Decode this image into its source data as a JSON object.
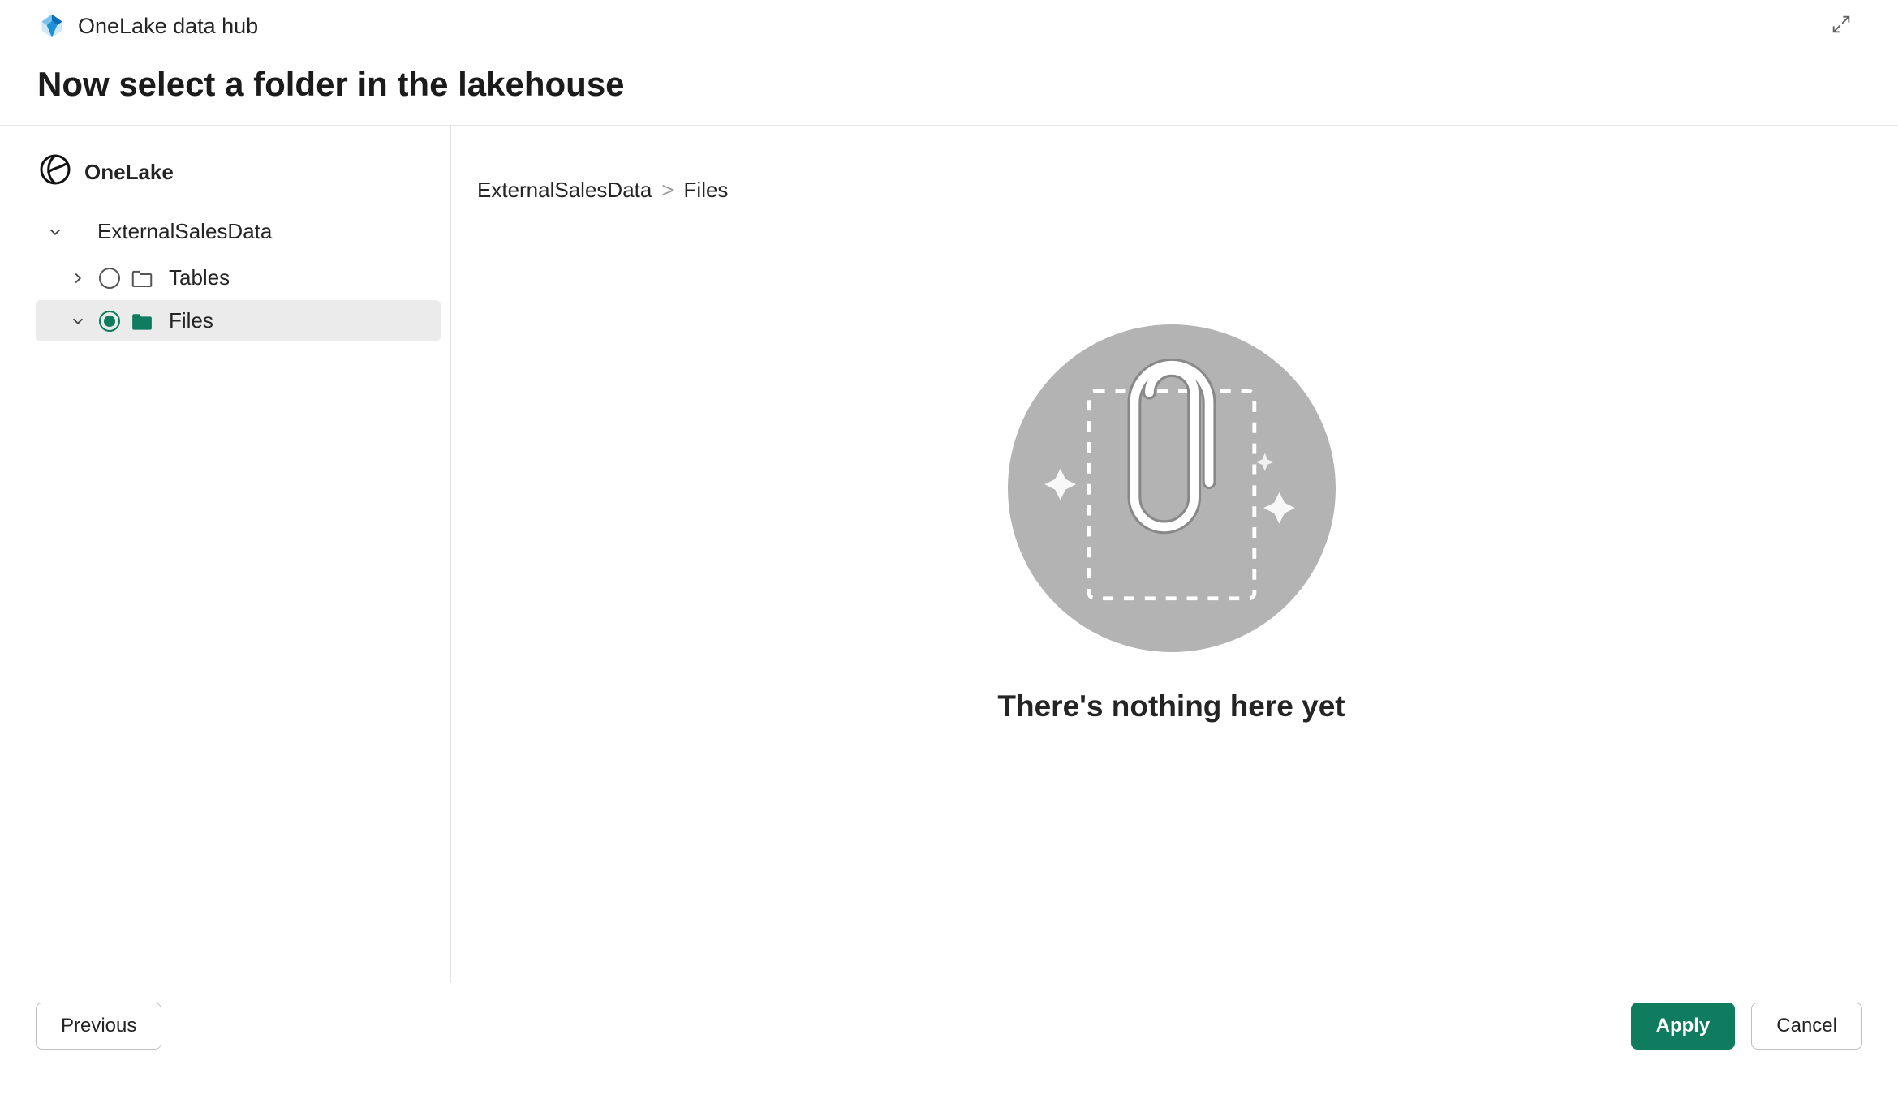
{
  "header": {
    "hub_label": "OneLake data hub",
    "heading": "Now select a folder in the lakehouse"
  },
  "sidebar": {
    "root_label": "OneLake",
    "lakehouse_label": "ExternalSalesData",
    "tables_label": "Tables",
    "files_label": "Files"
  },
  "breadcrumb": {
    "root": "ExternalSalesData",
    "sep": ">",
    "leaf": "Files"
  },
  "empty": {
    "message": "There's nothing here yet"
  },
  "footer": {
    "previous": "Previous",
    "apply": "Apply",
    "cancel": "Cancel"
  },
  "colors": {
    "accent": "#0f7b5f"
  }
}
